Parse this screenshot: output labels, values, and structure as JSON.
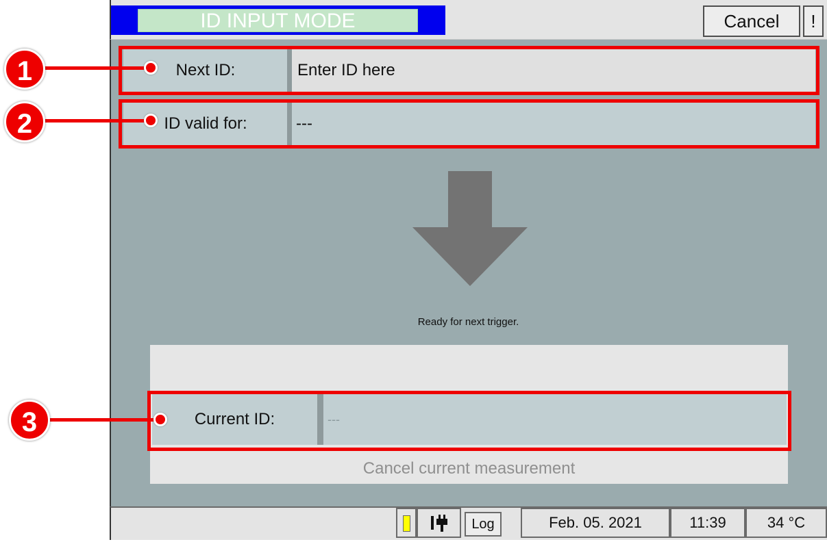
{
  "header": {
    "mode_title": "ID INPUT MODE",
    "cancel_label": "Cancel",
    "alert_label": "!"
  },
  "fields": {
    "next_id": {
      "label": "Next ID:",
      "placeholder": "Enter ID here"
    },
    "id_valid_for": {
      "label": "ID valid for:",
      "value": "---"
    },
    "current_id": {
      "label": "Current ID:",
      "value": "---"
    }
  },
  "status_message": "Ready for next trigger.",
  "cancel_measurement_label": "Cancel current measurement",
  "annotations": [
    "1",
    "2",
    "3"
  ],
  "statusbar": {
    "battery_icon": "battery-icon",
    "plug_icon": "plug-icon",
    "log_label": "Log",
    "date": "Feb. 05. 2021",
    "time": "11:39",
    "temperature": "34 °C"
  },
  "colors": {
    "screen_bg": "#9aabae",
    "mode_block": "#0000ee",
    "mode_label_bg": "#c4e6c8",
    "highlight": "#ee0000",
    "battery": "#ffff00"
  }
}
